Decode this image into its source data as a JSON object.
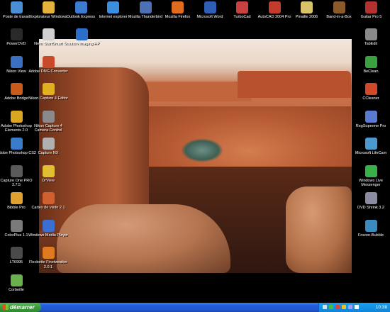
{
  "desktop": {
    "top_row": [
      {
        "label": "Poste de travail",
        "icon": "computer-icon",
        "color": "#4a8fd6"
      },
      {
        "label": "Explorateur Windows",
        "icon": "folder-explorer-icon",
        "color": "#e3b23c"
      },
      {
        "label": "Outlook Express",
        "icon": "outlook-express-icon",
        "color": "#3d7bd1"
      },
      {
        "label": "Internet explorer",
        "icon": "internet-explorer-icon",
        "color": "#3b8de0"
      },
      {
        "label": "Mozilla Thunderbird",
        "icon": "thunderbird-icon",
        "color": "#4d6fb3"
      },
      {
        "label": "Mozilla Firefox",
        "icon": "firefox-icon",
        "color": "#e06b1f"
      },
      {
        "label": "Microsoft Word",
        "icon": "word-icon",
        "color": "#2f5fb5"
      },
      {
        "label": "TurboCad",
        "icon": "turbocad-icon",
        "color": "#c94040"
      },
      {
        "label": "AutoCAD 2004 Pro",
        "icon": "autocad-icon",
        "color": "#c23b2b"
      },
      {
        "label": "Pinaille 2006",
        "icon": "pinaille-icon",
        "color": "#d9c36a"
      },
      {
        "label": "Band-in-a-Box",
        "icon": "band-in-a-box-icon",
        "color": "#8a5a2a"
      },
      {
        "label": "Guitar Pro 5",
        "icon": "guitar-pro-icon",
        "color": "#b53030"
      }
    ],
    "left_col": [
      {
        "label": "PowerDVD",
        "icon": "powerdvd-icon",
        "color": "#2a2a2a"
      },
      {
        "label": "Nikon View",
        "icon": "nikon-view-icon",
        "color": "#3a6fc2"
      },
      {
        "label": "Adobe Bridge",
        "icon": "adobe-bridge-icon",
        "color": "#c95a1a"
      },
      {
        "label": "Adobe Photoshop Elements 2.0",
        "icon": "photoshop-elements-icon",
        "color": "#d9a720"
      },
      {
        "label": "Adobe Photoshop CS2",
        "icon": "photoshop-cs2-icon",
        "color": "#3a7cc9"
      },
      {
        "label": "Capture One PRO 3.7.5",
        "icon": "capture-one-icon",
        "color": "#5a5a5a"
      },
      {
        "label": "Bibble Pro",
        "icon": "bibble-icon",
        "color": "#e0a030"
      },
      {
        "label": "ColorPlus 1.1",
        "icon": "colorplus-icon",
        "color": "#7a7a7a"
      },
      {
        "label": "LT6995",
        "icon": "lt6995-icon",
        "color": "#4a4a4a"
      },
      {
        "label": "Corbeille",
        "icon": "recycle-bin-icon",
        "color": "#6ab04c"
      }
    ],
    "second_col": [
      {
        "label": "Nero StartSmart",
        "icon": "nero-icon",
        "color": "#d0d0d0"
      },
      {
        "label": "Adobe DNG Converter",
        "icon": "dng-converter-icon",
        "color": "#c94a2a"
      },
      {
        "label": "Nikon Capture 4 Editor",
        "icon": "nikon-capture-editor-icon",
        "color": "#e0b020"
      },
      {
        "label": "Nikon Capture 4 Camera Control",
        "icon": "nikon-camera-control-icon",
        "color": "#8a8a8a"
      },
      {
        "label": "Capture NX",
        "icon": "capture-nx-icon",
        "color": "#b0b0b0"
      },
      {
        "label": "DrView",
        "icon": "drview-icon",
        "color": "#e0c030"
      },
      {
        "label": "Cartes de visite 2.1",
        "icon": "business-cards-icon",
        "color": "#d06030"
      },
      {
        "label": "Windows Media Player",
        "icon": "media-player-icon",
        "color": "#3a6fd0"
      },
      {
        "label": "Flecbette Finetweaker 2.0.1",
        "icon": "finetweaker-icon",
        "color": "#e07a20"
      }
    ],
    "hp_item": {
      "label": "Solution Imaging HP",
      "icon": "hp-icon",
      "color": "#2a6fc9"
    },
    "right_col": [
      {
        "label": "TabEdit",
        "icon": "tabedit-icon",
        "color": "#8a8a8a"
      },
      {
        "label": "BeClean",
        "icon": "beclean-icon",
        "color": "#3aa040"
      },
      {
        "label": "CCleaner",
        "icon": "ccleaner-icon",
        "color": "#d04a2a"
      },
      {
        "label": "RegSupreme Pro",
        "icon": "regsupreme-icon",
        "color": "#5a7ad0"
      },
      {
        "label": "Microsoft LifeCam",
        "icon": "lifecam-icon",
        "color": "#4a9ad0"
      },
      {
        "label": "Windows Live Messenger",
        "icon": "messenger-icon",
        "color": "#3ab04a"
      },
      {
        "label": "DVD Shrink 3.2",
        "icon": "dvd-shrink-icon",
        "color": "#8a8aa0"
      },
      {
        "label": "Frozen-Bubble",
        "icon": "frozen-bubble-icon",
        "color": "#3a8ac0"
      }
    ]
  },
  "taskbar": {
    "start_label": "démarrer",
    "clock": "10:38",
    "tray_colors": [
      "#e0e0e0",
      "#40c040",
      "#e04040",
      "#f0c020",
      "#a0a0ff",
      "#ffffff"
    ]
  }
}
